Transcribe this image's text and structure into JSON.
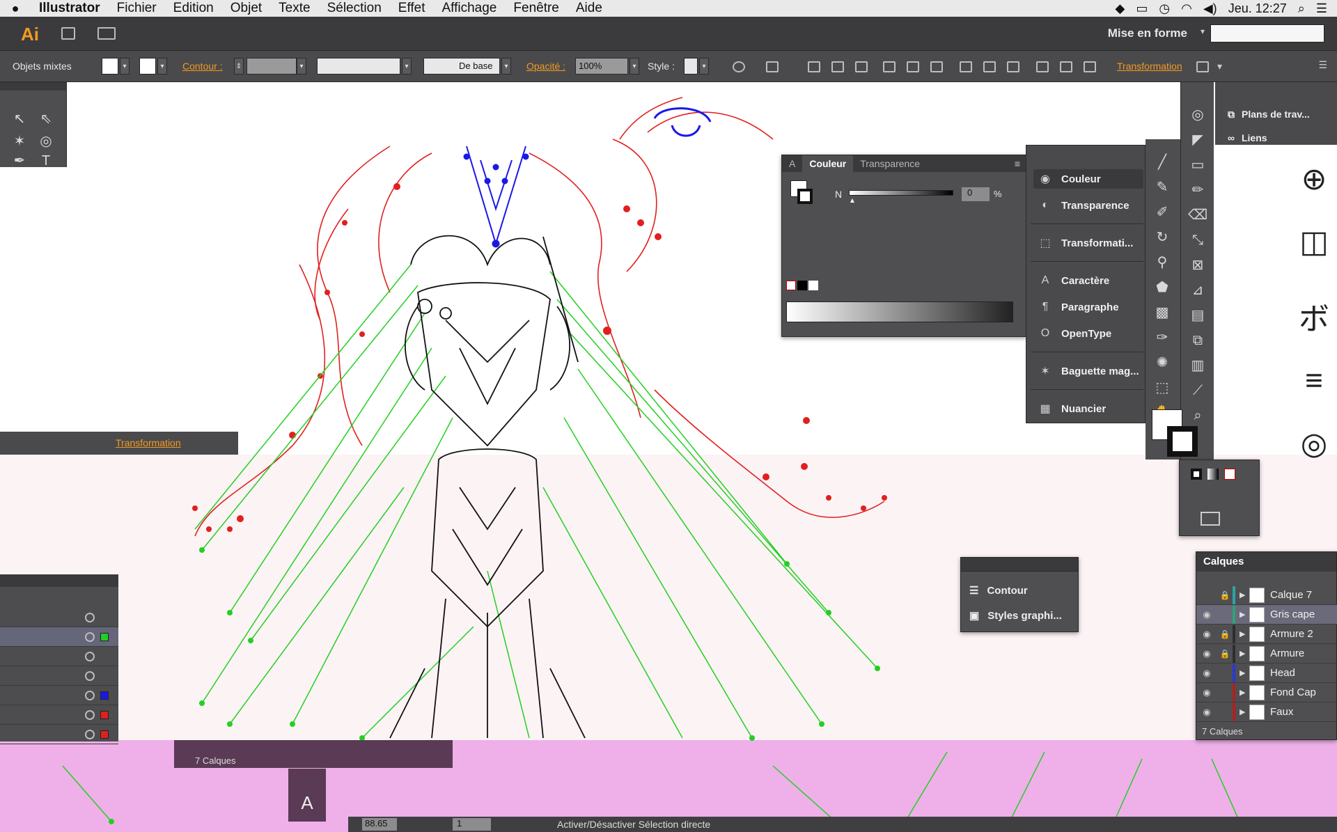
{
  "menubar": {
    "apple": "",
    "app": "Illustrator",
    "items": [
      "Fichier",
      "Edition",
      "Objet",
      "Texte",
      "Sélection",
      "Effet",
      "Affichage",
      "Fenêtre",
      "Aide"
    ],
    "clock": "Jeu. 12:27"
  },
  "appbar": {
    "logo": "Ai",
    "workspace": "Mise en forme"
  },
  "control": {
    "selection_type": "Objets mixtes",
    "contour_label": "Contour :",
    "stroke_profile": "De base",
    "opacity_label": "Opacité :",
    "opacity_value": "100%",
    "style_label": "Style :",
    "transformation": "Transformation"
  },
  "color_panel": {
    "tab_a": "A",
    "tab_color": "Couleur",
    "tab_transparency": "Transparence",
    "channel": "N",
    "value": "0",
    "unit": "%"
  },
  "dock": {
    "items": [
      {
        "label": "Couleur",
        "icon": "color-wheel-icon"
      },
      {
        "label": "Transparence",
        "icon": "transparency-icon"
      },
      {
        "label": "Transformati...",
        "icon": "transform-icon"
      },
      {
        "label": "Caractère",
        "icon": "character-icon"
      },
      {
        "label": "Paragraphe",
        "icon": "paragraph-icon"
      },
      {
        "label": "OpenType",
        "icon": "opentype-icon"
      },
      {
        "label": "Baguette mag...",
        "icon": "magic-wand-icon"
      },
      {
        "label": "Nuancier",
        "icon": "swatches-icon"
      }
    ]
  },
  "plans": {
    "artboards": "Plans de trav...",
    "links": "Liens"
  },
  "layers": {
    "title": "Calques",
    "rows": [
      {
        "name": "Calque 7",
        "color": "#2ea3a3",
        "eye": false,
        "lock": true,
        "selected": false
      },
      {
        "name": "Gris cape",
        "color": "#2ea37a",
        "eye": true,
        "lock": false,
        "selected": true
      },
      {
        "name": "Armure 2",
        "color": "#2e2e2e",
        "eye": true,
        "lock": true,
        "selected": false
      },
      {
        "name": "Armure",
        "color": "#2e2e2e",
        "eye": true,
        "lock": true,
        "selected": false
      },
      {
        "name": "Head",
        "color": "#2b36d6",
        "eye": true,
        "lock": false,
        "selected": false
      },
      {
        "name": "Fond Cap",
        "color": "#b02020",
        "eye": true,
        "lock": false,
        "selected": false
      },
      {
        "name": "Faux",
        "color": "#b02020",
        "eye": true,
        "lock": false,
        "selected": false
      }
    ],
    "footer": "7 Calques"
  },
  "contour_panel": {
    "items": [
      "Contour",
      "Styles graphi..."
    ]
  },
  "ghost": {
    "transformation": "Transformation",
    "layers_count": "7 Calques"
  },
  "status": {
    "zoom": "88.65",
    "page": "1",
    "message": "Activer/Désactiver Sélection directe"
  },
  "colors": {
    "accent": "#f49a1f",
    "red_layer": "#e0201f",
    "green_layer": "#22d022",
    "blue_layer": "#1a18e6"
  }
}
